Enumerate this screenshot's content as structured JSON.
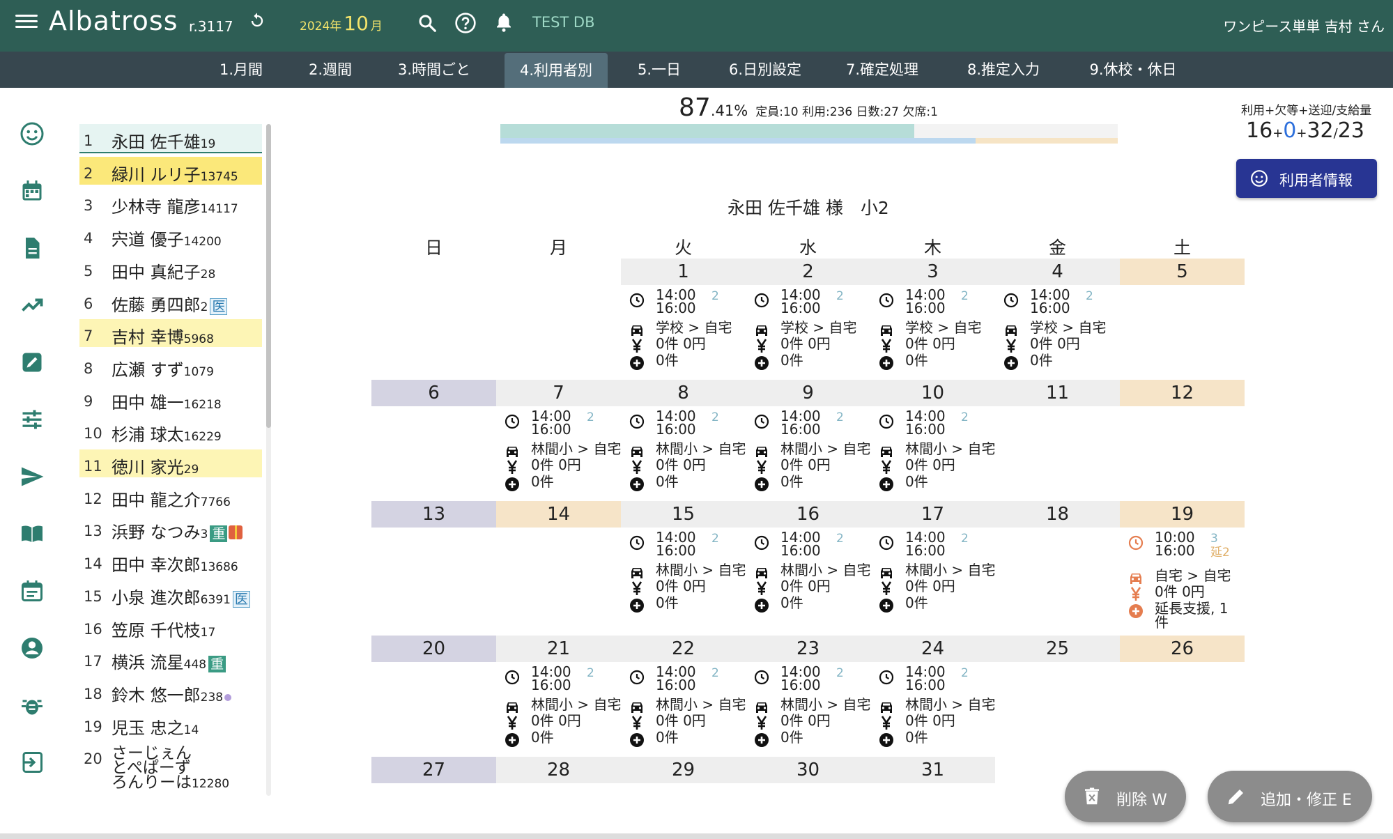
{
  "header": {
    "app_name": "Albatross",
    "version": "r.3117",
    "year_label": "2024年",
    "month_num": "10",
    "month_unit": "月",
    "db_label": "TEST DB",
    "user_label": "ワンピース単単 吉村 さん"
  },
  "nav": [
    {
      "label": "1.月間"
    },
    {
      "label": "2.週間"
    },
    {
      "label": "3.時間ごと"
    },
    {
      "label": "4.利用者別",
      "active": true
    },
    {
      "label": "5.一日"
    },
    {
      "label": "6.日別設定"
    },
    {
      "label": "7.確定処理"
    },
    {
      "label": "8.推定入力"
    },
    {
      "label": "9.休校・休日"
    }
  ],
  "users": [
    {
      "no": "1",
      "name": "永田 佐千雄",
      "count": "19",
      "bg": "#e6f4f2",
      "selected": true
    },
    {
      "no": "2",
      "name": "緑川 ルリ子",
      "count": "13745",
      "bg": "#fbe87a"
    },
    {
      "no": "3",
      "name": "少林寺 龍彦",
      "count": "14117"
    },
    {
      "no": "4",
      "name": "宍道 優子",
      "count": "14200"
    },
    {
      "no": "5",
      "name": "田中 真紀子",
      "count": "28"
    },
    {
      "no": "6",
      "name": "佐藤 勇四郎",
      "count": "2",
      "badge": "医"
    },
    {
      "no": "7",
      "name": "吉村 幸博",
      "count": "5968",
      "bg": "#fdf5b5"
    },
    {
      "no": "8",
      "name": "広瀬 すず",
      "count": "1079"
    },
    {
      "no": "9",
      "name": "田中 雄一",
      "count": "16218"
    },
    {
      "no": "10",
      "name": "杉浦 球太",
      "count": "16229"
    },
    {
      "no": "11",
      "name": "徳川 家光",
      "count": "29",
      "bg": "#fdf5b5"
    },
    {
      "no": "12",
      "name": "田中 龍之介",
      "count": "7766"
    },
    {
      "no": "13",
      "name": "浜野 なつみ",
      "count": "3",
      "badge": "重",
      "badge_green": true,
      "gift": true
    },
    {
      "no": "14",
      "name": "田中 幸次郎",
      "count": "13686"
    },
    {
      "no": "15",
      "name": "小泉 進次郎",
      "count": "6391",
      "badge": "医"
    },
    {
      "no": "16",
      "name": "笠原 千代枝",
      "count": "17"
    },
    {
      "no": "17",
      "name": "横浜 流星",
      "count": "448",
      "badge": "重",
      "badge_green": true
    },
    {
      "no": "18",
      "name": "鈴木 悠一郎",
      "count": "238",
      "dot": true
    },
    {
      "no": "19",
      "name": "児玉 忠之",
      "count": "14"
    },
    {
      "no": "20",
      "name": "さーじぇん\nとぺぱーず\nろんりーは",
      "count": "12280"
    }
  ],
  "summary": {
    "pct_int": "87",
    "pct_dec": ".41%",
    "meta": "定員:10 利用:236 日数:27 欠席:1",
    "progress": {
      "used": 0.67,
      "blue": 0.77,
      "orange": 0.23
    }
  },
  "right_summary": {
    "label": "利用+欠等+送迎/支給量",
    "v1": "16",
    "plus1": "+",
    "v2": "0",
    "plus2": "+",
    "v3": "32",
    "slash": "/",
    "v4": "23"
  },
  "info_button": "利用者情報",
  "calendar": {
    "title": "永田 佐千雄 様　小2",
    "weekdays": [
      "日",
      "月",
      "火",
      "水",
      "木",
      "金",
      "土"
    ],
    "weeks": [
      [
        null,
        null,
        "1",
        "2",
        "3",
        "4",
        "5"
      ],
      [
        "6",
        "7",
        "8",
        "9",
        "10",
        "11",
        "12"
      ],
      [
        "13",
        "14",
        "15",
        "16",
        "17",
        "18",
        "19"
      ],
      [
        "20",
        "21",
        "22",
        "23",
        "24",
        "25",
        "26"
      ],
      [
        "27",
        "28",
        "29",
        "30",
        "31",
        null,
        null
      ]
    ],
    "entries": {
      "1": {
        "t1": "14:00",
        "t2": "16:00",
        "cnt": "2",
        "route": "学校 > 自宅",
        "fee": "0件 0円",
        "extra": "0件"
      },
      "2": {
        "t1": "14:00",
        "t2": "16:00",
        "cnt": "2",
        "route": "学校 > 自宅",
        "fee": "0件 0円",
        "extra": "0件"
      },
      "3": {
        "t1": "14:00",
        "t2": "16:00",
        "cnt": "2",
        "route": "学校 > 自宅",
        "fee": "0件 0円",
        "extra": "0件"
      },
      "4": {
        "t1": "14:00",
        "t2": "16:00",
        "cnt": "2",
        "route": "学校 > 自宅",
        "fee": "0件 0円",
        "extra": "0件"
      },
      "7": {
        "t1": "14:00",
        "t2": "16:00",
        "cnt": "2",
        "route": "林間小 > 自宅",
        "fee": "0件 0円",
        "extra": "0件"
      },
      "8": {
        "t1": "14:00",
        "t2": "16:00",
        "cnt": "2",
        "route": "林間小 > 自宅",
        "fee": "0件 0円",
        "extra": "0件"
      },
      "9": {
        "t1": "14:00",
        "t2": "16:00",
        "cnt": "2",
        "route": "林間小 > 自宅",
        "fee": "0件 0円",
        "extra": "0件"
      },
      "10": {
        "t1": "14:00",
        "t2": "16:00",
        "cnt": "2",
        "route": "林間小 > 自宅",
        "fee": "0件 0円",
        "extra": "0件"
      },
      "15": {
        "t1": "14:00",
        "t2": "16:00",
        "cnt": "2",
        "route": "林間小 > 自宅",
        "fee": "0件 0円",
        "extra": "0件"
      },
      "16": {
        "t1": "14:00",
        "t2": "16:00",
        "cnt": "2",
        "route": "林間小 > 自宅",
        "fee": "0件 0円",
        "extra": "0件"
      },
      "17": {
        "t1": "14:00",
        "t2": "16:00",
        "cnt": "2",
        "route": "林間小 > 自宅",
        "fee": "0件 0円",
        "extra": "0件"
      },
      "19": {
        "t1": "10:00",
        "t2": "16:00",
        "cnt": "3",
        "cnt2": "延2",
        "route": "自宅 > 自宅",
        "fee": "0件 0円",
        "extra": "延長支援, 1",
        "extra2": "件",
        "holiday": true
      },
      "21": {
        "t1": "14:00",
        "t2": "16:00",
        "cnt": "2",
        "route": "林間小 > 自宅",
        "fee": "0件 0円",
        "extra": "0件"
      },
      "22": {
        "t1": "14:00",
        "t2": "16:00",
        "cnt": "2",
        "route": "林間小 > 自宅",
        "fee": "0件 0円",
        "extra": "0件"
      },
      "23": {
        "t1": "14:00",
        "t2": "16:00",
        "cnt": "2",
        "route": "林間小 > 自宅",
        "fee": "0件 0円",
        "extra": "0件"
      },
      "24": {
        "t1": "14:00",
        "t2": "16:00",
        "cnt": "2",
        "route": "林間小 > 自宅",
        "fee": "0件 0円",
        "extra": "0件"
      }
    },
    "colors": {
      "sunday": "#d4d3e2",
      "saturday": "#f6e4c8",
      "weekday": "#eeeeee",
      "holiday_orange": "#f6e4c8"
    }
  },
  "fab_delete": "削除 W",
  "fab_edit": "追加・修正 E"
}
